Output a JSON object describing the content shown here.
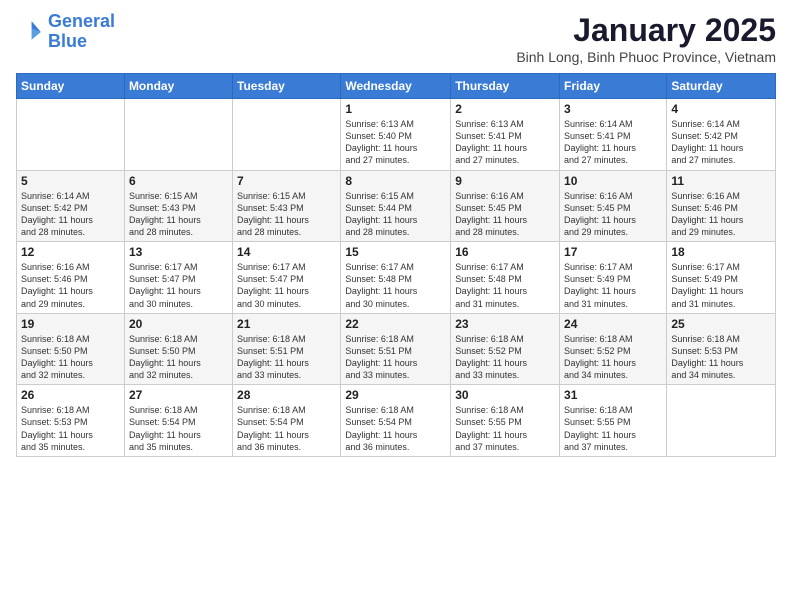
{
  "logo": {
    "line1": "General",
    "line2": "Blue"
  },
  "title": "January 2025",
  "subtitle": "Binh Long, Binh Phuoc Province, Vietnam",
  "days_of_week": [
    "Sunday",
    "Monday",
    "Tuesday",
    "Wednesday",
    "Thursday",
    "Friday",
    "Saturday"
  ],
  "weeks": [
    [
      {
        "day": "",
        "info": ""
      },
      {
        "day": "",
        "info": ""
      },
      {
        "day": "",
        "info": ""
      },
      {
        "day": "1",
        "info": "Sunrise: 6:13 AM\nSunset: 5:40 PM\nDaylight: 11 hours\nand 27 minutes."
      },
      {
        "day": "2",
        "info": "Sunrise: 6:13 AM\nSunset: 5:41 PM\nDaylight: 11 hours\nand 27 minutes."
      },
      {
        "day": "3",
        "info": "Sunrise: 6:14 AM\nSunset: 5:41 PM\nDaylight: 11 hours\nand 27 minutes."
      },
      {
        "day": "4",
        "info": "Sunrise: 6:14 AM\nSunset: 5:42 PM\nDaylight: 11 hours\nand 27 minutes."
      }
    ],
    [
      {
        "day": "5",
        "info": "Sunrise: 6:14 AM\nSunset: 5:42 PM\nDaylight: 11 hours\nand 28 minutes."
      },
      {
        "day": "6",
        "info": "Sunrise: 6:15 AM\nSunset: 5:43 PM\nDaylight: 11 hours\nand 28 minutes."
      },
      {
        "day": "7",
        "info": "Sunrise: 6:15 AM\nSunset: 5:43 PM\nDaylight: 11 hours\nand 28 minutes."
      },
      {
        "day": "8",
        "info": "Sunrise: 6:15 AM\nSunset: 5:44 PM\nDaylight: 11 hours\nand 28 minutes."
      },
      {
        "day": "9",
        "info": "Sunrise: 6:16 AM\nSunset: 5:45 PM\nDaylight: 11 hours\nand 28 minutes."
      },
      {
        "day": "10",
        "info": "Sunrise: 6:16 AM\nSunset: 5:45 PM\nDaylight: 11 hours\nand 29 minutes."
      },
      {
        "day": "11",
        "info": "Sunrise: 6:16 AM\nSunset: 5:46 PM\nDaylight: 11 hours\nand 29 minutes."
      }
    ],
    [
      {
        "day": "12",
        "info": "Sunrise: 6:16 AM\nSunset: 5:46 PM\nDaylight: 11 hours\nand 29 minutes."
      },
      {
        "day": "13",
        "info": "Sunrise: 6:17 AM\nSunset: 5:47 PM\nDaylight: 11 hours\nand 30 minutes."
      },
      {
        "day": "14",
        "info": "Sunrise: 6:17 AM\nSunset: 5:47 PM\nDaylight: 11 hours\nand 30 minutes."
      },
      {
        "day": "15",
        "info": "Sunrise: 6:17 AM\nSunset: 5:48 PM\nDaylight: 11 hours\nand 30 minutes."
      },
      {
        "day": "16",
        "info": "Sunrise: 6:17 AM\nSunset: 5:48 PM\nDaylight: 11 hours\nand 31 minutes."
      },
      {
        "day": "17",
        "info": "Sunrise: 6:17 AM\nSunset: 5:49 PM\nDaylight: 11 hours\nand 31 minutes."
      },
      {
        "day": "18",
        "info": "Sunrise: 6:17 AM\nSunset: 5:49 PM\nDaylight: 11 hours\nand 31 minutes."
      }
    ],
    [
      {
        "day": "19",
        "info": "Sunrise: 6:18 AM\nSunset: 5:50 PM\nDaylight: 11 hours\nand 32 minutes."
      },
      {
        "day": "20",
        "info": "Sunrise: 6:18 AM\nSunset: 5:50 PM\nDaylight: 11 hours\nand 32 minutes."
      },
      {
        "day": "21",
        "info": "Sunrise: 6:18 AM\nSunset: 5:51 PM\nDaylight: 11 hours\nand 33 minutes."
      },
      {
        "day": "22",
        "info": "Sunrise: 6:18 AM\nSunset: 5:51 PM\nDaylight: 11 hours\nand 33 minutes."
      },
      {
        "day": "23",
        "info": "Sunrise: 6:18 AM\nSunset: 5:52 PM\nDaylight: 11 hours\nand 33 minutes."
      },
      {
        "day": "24",
        "info": "Sunrise: 6:18 AM\nSunset: 5:52 PM\nDaylight: 11 hours\nand 34 minutes."
      },
      {
        "day": "25",
        "info": "Sunrise: 6:18 AM\nSunset: 5:53 PM\nDaylight: 11 hours\nand 34 minutes."
      }
    ],
    [
      {
        "day": "26",
        "info": "Sunrise: 6:18 AM\nSunset: 5:53 PM\nDaylight: 11 hours\nand 35 minutes."
      },
      {
        "day": "27",
        "info": "Sunrise: 6:18 AM\nSunset: 5:54 PM\nDaylight: 11 hours\nand 35 minutes."
      },
      {
        "day": "28",
        "info": "Sunrise: 6:18 AM\nSunset: 5:54 PM\nDaylight: 11 hours\nand 36 minutes."
      },
      {
        "day": "29",
        "info": "Sunrise: 6:18 AM\nSunset: 5:54 PM\nDaylight: 11 hours\nand 36 minutes."
      },
      {
        "day": "30",
        "info": "Sunrise: 6:18 AM\nSunset: 5:55 PM\nDaylight: 11 hours\nand 37 minutes."
      },
      {
        "day": "31",
        "info": "Sunrise: 6:18 AM\nSunset: 5:55 PM\nDaylight: 11 hours\nand 37 minutes."
      },
      {
        "day": "",
        "info": ""
      }
    ]
  ]
}
